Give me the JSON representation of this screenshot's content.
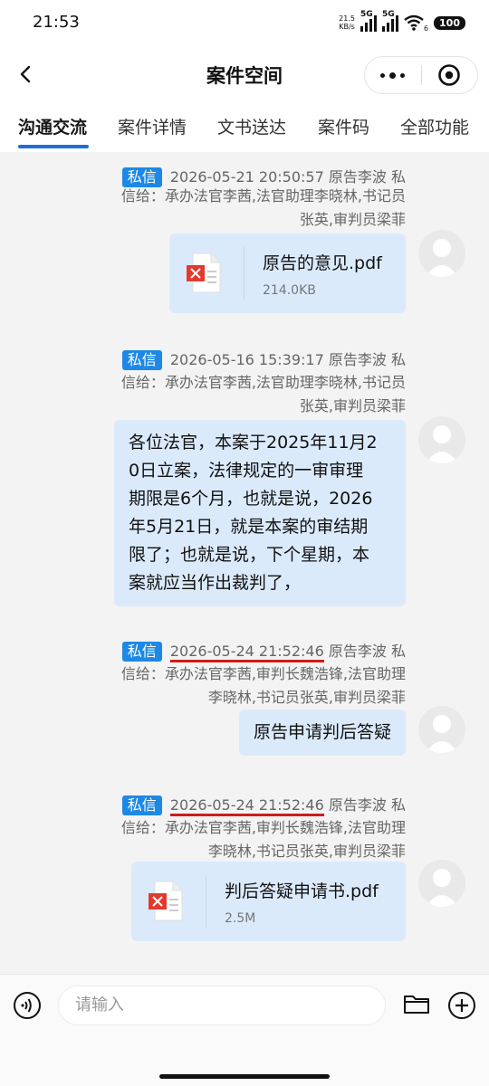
{
  "status_bar": {
    "time": "21:53",
    "speed_value": "21.5",
    "speed_unit": "KB/s",
    "net1": "5G",
    "net2": "5G",
    "wifi_sub": "6",
    "battery": "100"
  },
  "header": {
    "title": "案件空间",
    "back_icon": "chevron-left-icon",
    "more_icon": "more-dots-icon",
    "close_icon": "target-circle-icon"
  },
  "tabs": [
    {
      "label": "沟通交流",
      "active": true
    },
    {
      "label": "案件详情",
      "active": false
    },
    {
      "label": "文书送达",
      "active": false
    },
    {
      "label": "案件码",
      "active": false
    },
    {
      "label": "全部功能",
      "active": false
    }
  ],
  "messages": [
    {
      "badge": "私信",
      "timestamp": "2026-05-21 20:50:57",
      "sender": "原告李波",
      "type_char": "私",
      "recipients_line1": "信给：承办法官李茜,法官助理李晓林,书记员",
      "recipients_line2": "张英,审判员梁菲",
      "file_name": "原告的意见.pdf",
      "file_size": "214.0KB"
    },
    {
      "badge": "私信",
      "timestamp": "2026-05-16 15:39:17",
      "sender": "原告李波",
      "type_char": "私",
      "recipients_line1": "信给：承办法官李茜,法官助理李晓林,书记员",
      "recipients_line2": "张英,审判员梁菲",
      "text_lines": [
        "各位法官，本案于2025年11月2",
        "0日立案，法律规定的一审审理",
        "期限是6个月，也就是说，2026",
        "年5月21日，就是本案的审结期",
        "限了；也就是说，下个星期，本",
        "案就应当作出裁判了，"
      ]
    },
    {
      "badge": "私信",
      "timestamp": "2026-05-24 21:52:46",
      "sender": "原告李波",
      "type_char": "私",
      "recipients_line1": "信给：承办法官李茜,审判长魏浩锋,法官助理",
      "recipients_line2": "李晓林,书记员张英,审判员梁菲",
      "text": "原告申请判后答疑"
    },
    {
      "badge": "私信",
      "timestamp": "2026-05-24 21:52:46",
      "sender": "原告李波",
      "type_char": "私",
      "recipients_line1": "信给：承办法官李茜,审判长魏浩锋,法官助理",
      "recipients_line2": "李晓林,书记员张英,审判员梁菲",
      "file_name": "判后答疑申请书.pdf",
      "file_size": "2.5M"
    }
  ],
  "input_bar": {
    "placeholder": "请输入",
    "voice_icon": "voice-icon",
    "folder_icon": "folder-icon",
    "plus_icon": "plus-circle-icon"
  },
  "colors": {
    "accent": "#1e6fd9",
    "badge": "#1e88e5",
    "bubble": "#dbeafb",
    "underline_annotation": "#d11b1b",
    "chat_bg": "#f3f3f3"
  }
}
